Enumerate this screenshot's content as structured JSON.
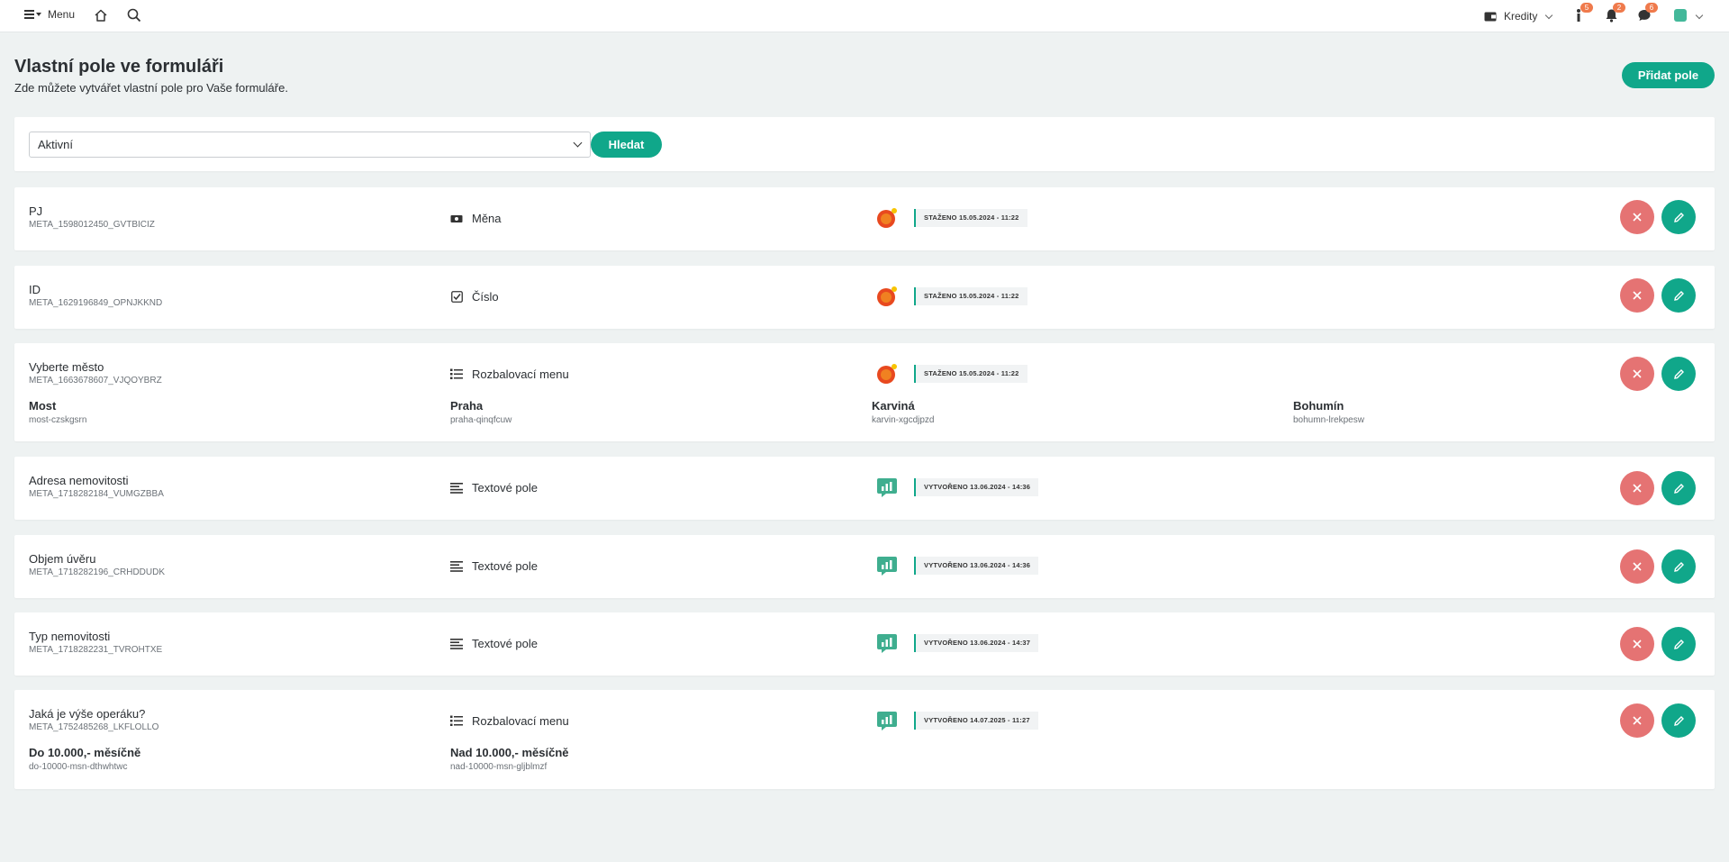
{
  "topbar": {
    "menu_label": "Menu",
    "home_icon": "home-icon",
    "search_icon": "search-icon",
    "credits_label": "Kredity",
    "notifications": [
      {
        "icon": "info-icon",
        "count": "5"
      },
      {
        "icon": "bell-icon",
        "count": "2"
      },
      {
        "icon": "chat-icon",
        "count": "6"
      }
    ],
    "accent": "#10a78a"
  },
  "header": {
    "title": "Vlastní pole ve formuláři",
    "subtitle": "Zde můžete vytvářet vlastní pole pro Vaše formuláře.",
    "add_button": "Přidat pole"
  },
  "filter": {
    "selected": "Aktivní",
    "search_button": "Hledat"
  },
  "rows": [
    {
      "name": "PJ",
      "key": "META_1598012450_GVTBICIZ",
      "type": "Měna",
      "type_icon": "cash-icon",
      "source": "orange-logo",
      "stamp": "STAŽENO 15.05.2024 - 11:22",
      "options": []
    },
    {
      "name": "ID",
      "key": "META_1629196849_OPNJKKND",
      "type": "Číslo",
      "type_icon": "checkbox-icon",
      "source": "orange-logo",
      "stamp": "STAŽENO 15.05.2024 - 11:22",
      "options": []
    },
    {
      "name": "Vyberte město",
      "key": "META_1663678607_VJQOYBRZ",
      "type": "Rozbalovací menu",
      "type_icon": "list-icon",
      "source": "orange-logo",
      "stamp": "STAŽENO 15.05.2024 - 11:22",
      "options": [
        {
          "label": "Most",
          "key": "most-czskgsrn"
        },
        {
          "label": "Praha",
          "key": "praha-qinqfcuw"
        },
        {
          "label": "Karviná",
          "key": "karvin-xgcdjpzd"
        },
        {
          "label": "Bohumín",
          "key": "bohumn-lrekpesw"
        }
      ]
    },
    {
      "name": "Adresa nemovitosti",
      "key": "META_1718282184_VUMGZBBA",
      "type": "Textové pole",
      "type_icon": "text-lines-icon",
      "source": "green-chat-logo",
      "stamp": "VYTVOŘENO 13.06.2024 - 14:36",
      "options": []
    },
    {
      "name": "Objem úvěru",
      "key": "META_1718282196_CRHDDUDK",
      "type": "Textové pole",
      "type_icon": "text-lines-icon",
      "source": "green-chat-logo",
      "stamp": "VYTVOŘENO 13.06.2024 - 14:36",
      "options": []
    },
    {
      "name": "Typ nemovitosti",
      "key": "META_1718282231_TVROHTXE",
      "type": "Textové pole",
      "type_icon": "text-lines-icon",
      "source": "green-chat-logo",
      "stamp": "VYTVOŘENO 13.06.2024 - 14:37",
      "options": []
    },
    {
      "name": "Jaká je výše operáku?",
      "key": "META_1752485268_LKFLOLLO",
      "type": "Rozbalovací menu",
      "type_icon": "list-icon",
      "source": "green-chat-logo",
      "stamp": "VYTVOŘENO 14.07.2025 - 11:27",
      "options": [
        {
          "label": "Do 10.000,- měsíčně",
          "key": "do-10000-msn-dthwhtwc"
        },
        {
          "label": "Nad 10.000,- měsíčně",
          "key": "nad-10000-msn-gljblmzf"
        }
      ]
    }
  ]
}
